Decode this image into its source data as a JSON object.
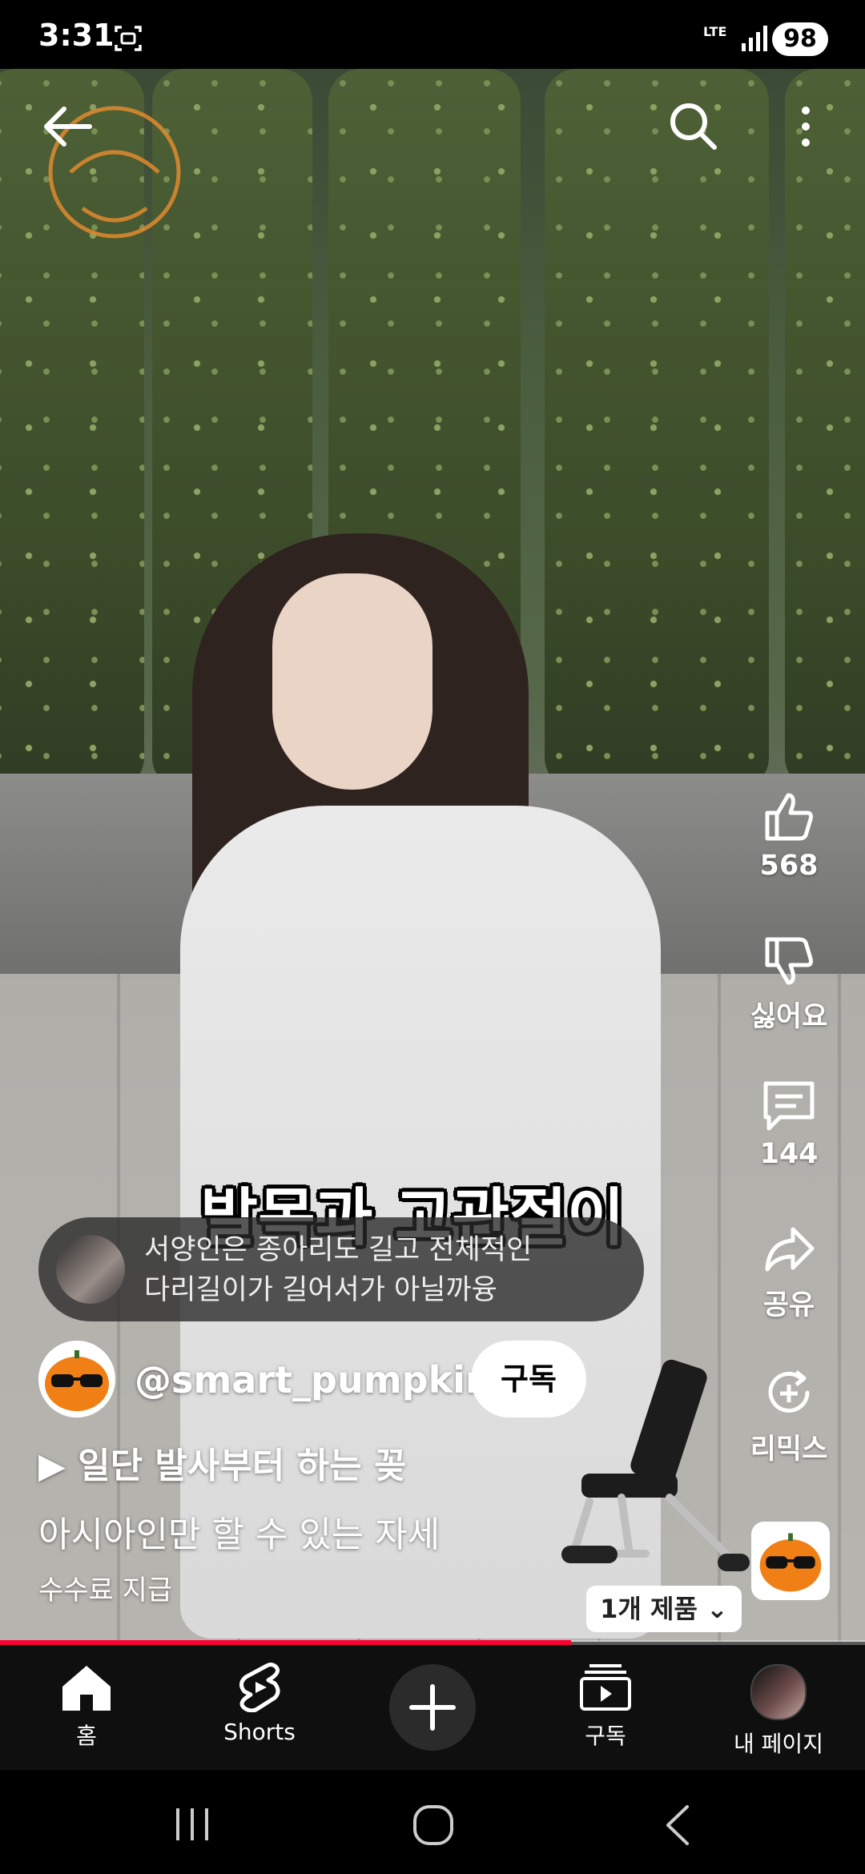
{
  "status_bar": {
    "time": "3:31",
    "network": "LTE",
    "battery": "98"
  },
  "video": {
    "caption": "발목과 고관절이",
    "progress_fraction": 0.66
  },
  "top_bar": {
    "back_icon": "arrow-left-icon",
    "search_icon": "search-icon",
    "more_icon": "more-vertical-icon"
  },
  "actions": {
    "like_count": "568",
    "dislike_label": "싫어요",
    "comment_count": "144",
    "share_label": "공유",
    "remix_label": "리믹스"
  },
  "comment_preview": {
    "line1": "서양인은 종아리도 길고 전체적인",
    "line2": "다리길이가 길어서가 아닐까융"
  },
  "channel": {
    "handle": "@smart_pumpkin",
    "subscribe_label": "구독"
  },
  "music": {
    "text": "▶ 일단 발사부터 하는 꽂"
  },
  "title": "아시아인만 할 수 있는 자세",
  "paid_promotion": "수수료 지급",
  "product": {
    "chip_label": "1개 제품 ⌄"
  },
  "bottom_nav": {
    "home": "홈",
    "shorts": "Shorts",
    "subscriptions": "구독",
    "my_page": "내 페이지"
  },
  "colors": {
    "progress": "#ff0033",
    "nav_background": "#0f0f0f"
  }
}
